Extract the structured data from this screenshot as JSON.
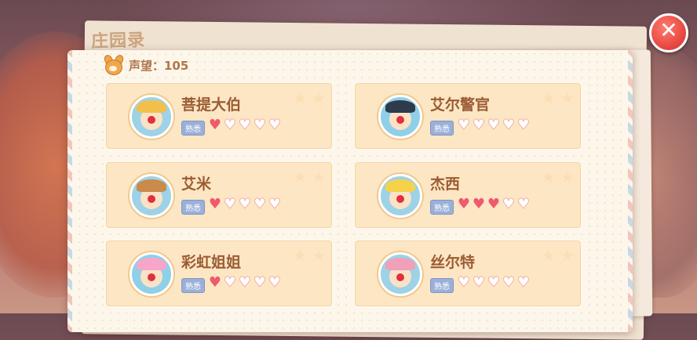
{
  "book_title": "庄园录",
  "reputation": {
    "label": "声望：105"
  },
  "close_label": "✕",
  "npcs": [
    {
      "name": "菩提大伯",
      "tag": "熟悉",
      "hearts_filled": 1,
      "hearts_total": 5,
      "hat_color": "#f2c04a",
      "bg_color": "#9ed2e6"
    },
    {
      "name": "艾尔警官",
      "tag": "熟悉",
      "hearts_filled": 0,
      "hearts_total": 5,
      "hat_color": "#2f3a4a",
      "bg_color": "#8fd0e8"
    },
    {
      "name": "艾米",
      "tag": "熟悉",
      "hearts_filled": 1,
      "hearts_total": 5,
      "hat_color": "#c98a4a",
      "bg_color": "#9ed2e6"
    },
    {
      "name": "杰西",
      "tag": "熟悉",
      "hearts_filled": 3,
      "hearts_total": 5,
      "hat_color": "#f5d24a",
      "bg_color": "#9ed2e6"
    },
    {
      "name": "彩虹姐姐",
      "tag": "熟悉",
      "hearts_filled": 1,
      "hearts_total": 5,
      "hat_color": "#f6a6c8",
      "bg_color": "#8fd0e8"
    },
    {
      "name": "丝尔特",
      "tag": "熟悉",
      "hearts_filled": 0,
      "hearts_total": 5,
      "hat_color": "#f0a0b8",
      "bg_color": "#9ed2e6"
    }
  ],
  "colors": {
    "heart_on": "#ef5a6c",
    "card_bg": "#fde6c4",
    "close": "#e94b43"
  }
}
